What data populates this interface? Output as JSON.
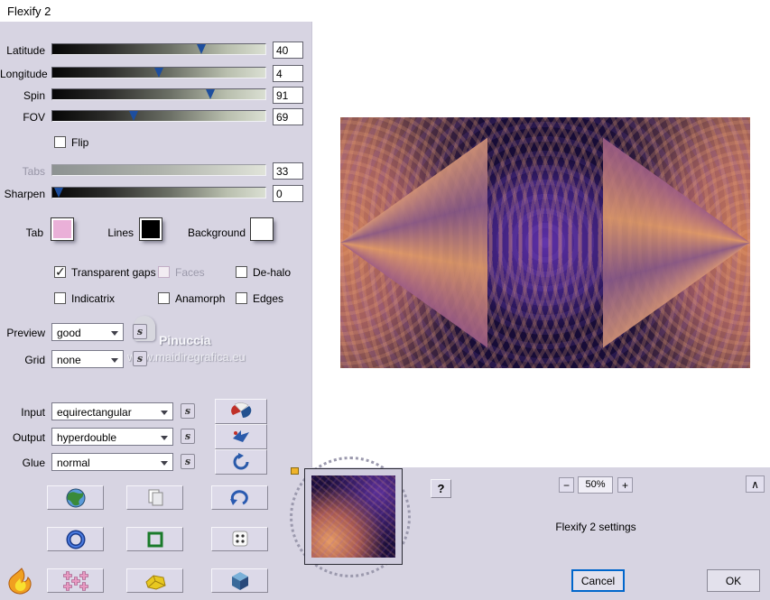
{
  "window": {
    "title": "Flexify 2"
  },
  "colors": {
    "panel": "#d7d4e2",
    "focus": "#0066cc",
    "tab_swatch": "#eab0d8",
    "lines_swatch": "#000000",
    "background_swatch": "#ffffff"
  },
  "sliders": {
    "rows": [
      {
        "label": "Latitude",
        "value": "40",
        "fraction": 0.7
      },
      {
        "label": "Longitude",
        "value": "4",
        "fraction": 0.5
      },
      {
        "label": "Spin",
        "value": "91",
        "fraction": 0.74
      },
      {
        "label": "FOV",
        "value": "69",
        "fraction": 0.38
      }
    ],
    "tabs": {
      "label": "Tabs",
      "value": "33"
    },
    "sharpen": {
      "label": "Sharpen",
      "value": "0",
      "fraction": 0.03
    }
  },
  "flip": {
    "label": "Flip",
    "checked": false
  },
  "swatches": {
    "tab": {
      "label": "Tab"
    },
    "lines": {
      "label": "Lines"
    },
    "background": {
      "label": "Background"
    }
  },
  "options": {
    "transparent_gaps": {
      "label": "Transparent gaps",
      "checked": true
    },
    "faces": {
      "label": "Faces",
      "checked": false
    },
    "de_halo": {
      "label": "De-halo",
      "checked": false
    },
    "indicatrix": {
      "label": "Indicatrix",
      "checked": false
    },
    "anamorph": {
      "label": "Anamorph",
      "checked": false
    },
    "edges": {
      "label": "Edges",
      "checked": false
    }
  },
  "combos": {
    "preview": {
      "label": "Preview",
      "value": "good"
    },
    "grid": {
      "label": "Grid",
      "value": "none"
    },
    "input": {
      "label": "Input",
      "value": "equirectangular"
    },
    "output": {
      "label": "Output",
      "value": "hyperdouble"
    },
    "glue": {
      "label": "Glue",
      "value": "normal"
    }
  },
  "icons": {
    "seed_glyph": "s",
    "help_glyph": "?",
    "collapse_glyph": "∧",
    "zoom_out_glyph": "−",
    "zoom_in_glyph": "+"
  },
  "watermark": {
    "line1": "Pinuccia",
    "line2": "www.maidiregrafica.eu"
  },
  "footer": {
    "zoom_value": "50%",
    "settings_text": "Flexify 2 settings",
    "cancel_label": "Cancel",
    "ok_label": "OK"
  }
}
